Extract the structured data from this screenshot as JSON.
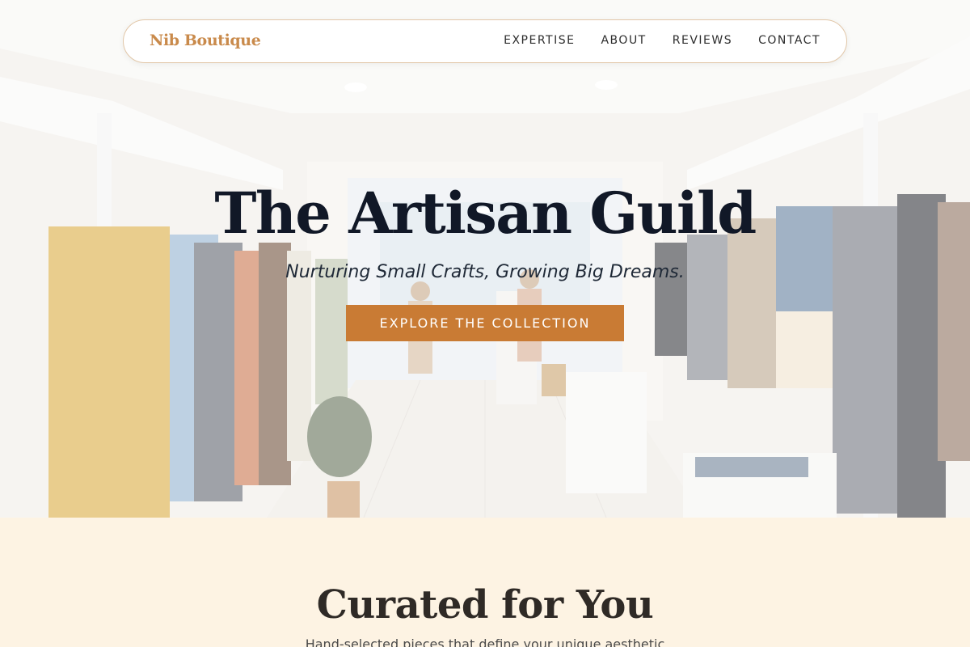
{
  "nav": {
    "brand": "Nib Boutique",
    "links": [
      "EXPERTISE",
      "ABOUT",
      "REVIEWS",
      "CONTACT"
    ]
  },
  "hero": {
    "title": "The Artisan Guild",
    "subtitle": "Nurturing Small Crafts, Growing Big Dreams.",
    "cta_label": "EXPLORE THE COLLECTION",
    "image_icon": "boutique-interior-photo"
  },
  "curated": {
    "title": "Curated for You",
    "description": "Hand-selected pieces that define your unique aesthetic"
  },
  "colors": {
    "brand": "#c98a4b",
    "accent": "#c97b34",
    "section_bg": "#fdf3e3",
    "title_text": "#111827"
  }
}
